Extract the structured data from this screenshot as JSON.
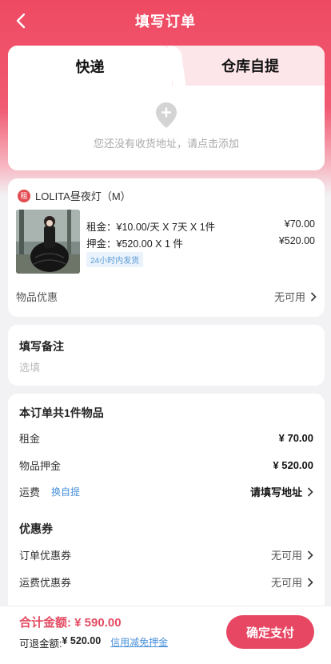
{
  "header": {
    "title": "填写订单"
  },
  "delivery_tabs": [
    {
      "label": "快递",
      "active": true
    },
    {
      "label": "仓库自提",
      "active": false
    }
  ],
  "address": {
    "empty_text": "您还没有收货地址，请点击添加"
  },
  "goods": {
    "badge": "租",
    "name": "LOLITA昼夜灯（M）",
    "rent_line": "租金：¥10.00/天 X 7天 X 1件",
    "rent_amount": "¥70.00",
    "deposit_line": "押金：¥520.00 X 1 件",
    "deposit_amount": "¥520.00",
    "ship_tag": "24小时内发货",
    "discount_label": "物品优惠",
    "discount_value": "无可用"
  },
  "remark": {
    "title": "填写备注",
    "placeholder": "选填"
  },
  "summary": {
    "title": "本订单共1件物品",
    "rent_label": "租金",
    "rent_value": "¥ 70.00",
    "deposit_label": "物品押金",
    "deposit_value": "¥ 520.00",
    "freight_label": "运费",
    "freight_switch": "换自提",
    "freight_value": "请填写地址",
    "coupon_title": "优惠券",
    "order_coupon_label": "订单优惠券",
    "order_coupon_value": "无可用",
    "freight_coupon_label": "运费优惠券",
    "freight_coupon_value": "无可用"
  },
  "bottom": {
    "total": "合计金额: ¥ 590.00",
    "refund_label": "可退金额: ",
    "refund_amount": "¥ 520.00",
    "credit_link": "信用减免押金",
    "pay_button": "确定支付"
  },
  "colors": {
    "brand": "#ef4a63",
    "link": "#4a90d9",
    "badge": "#e34b52"
  },
  "icons": [
    "back-icon",
    "location-pin-icon",
    "chevron-right-icon"
  ]
}
